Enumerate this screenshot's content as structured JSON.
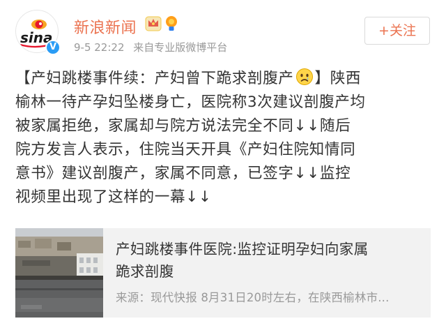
{
  "header": {
    "account_name": "新浪新闻",
    "account_icons": [
      "vip-crown-icon",
      "lightbulb-icon"
    ],
    "timestamp": "9-5 22:22",
    "source": "来自专业版微博平台",
    "follow_label": "+关注",
    "avatar_logo": "sina",
    "verified_icon": "verified-v-icon"
  },
  "post": {
    "line1_a": "【产妇跳楼事件续：产妇曾下跪求剖腹产",
    "line1_emoji": "sad-face-emoji-icon",
    "line1_b": "】陕西",
    "line2": "榆林一待产孕妇坠楼身亡，医院称3次建议剖腹产均",
    "line3": "被家属拒绝，家属却与院方说法完全不同↓↓随后",
    "line4": "院方发言人表示，住院当天开具《产妇住院知情同",
    "line5": "意书》建议剖腹产，家属不同意，已签字↓↓监控",
    "line6": "视频里出现了这样的一幕↓↓"
  },
  "card": {
    "title_line1": "产妇跳楼事件医院:监控证明孕妇向家属",
    "title_line2": "跪求剖腹",
    "source_text": "来源：现代快报 8月31日20时左右，在陕西榆林市..."
  },
  "colors": {
    "accent": "#eb7350",
    "verified_blue": "#2a9cf5",
    "meta_gray": "#999999",
    "card_bg": "#f2f2f2"
  }
}
